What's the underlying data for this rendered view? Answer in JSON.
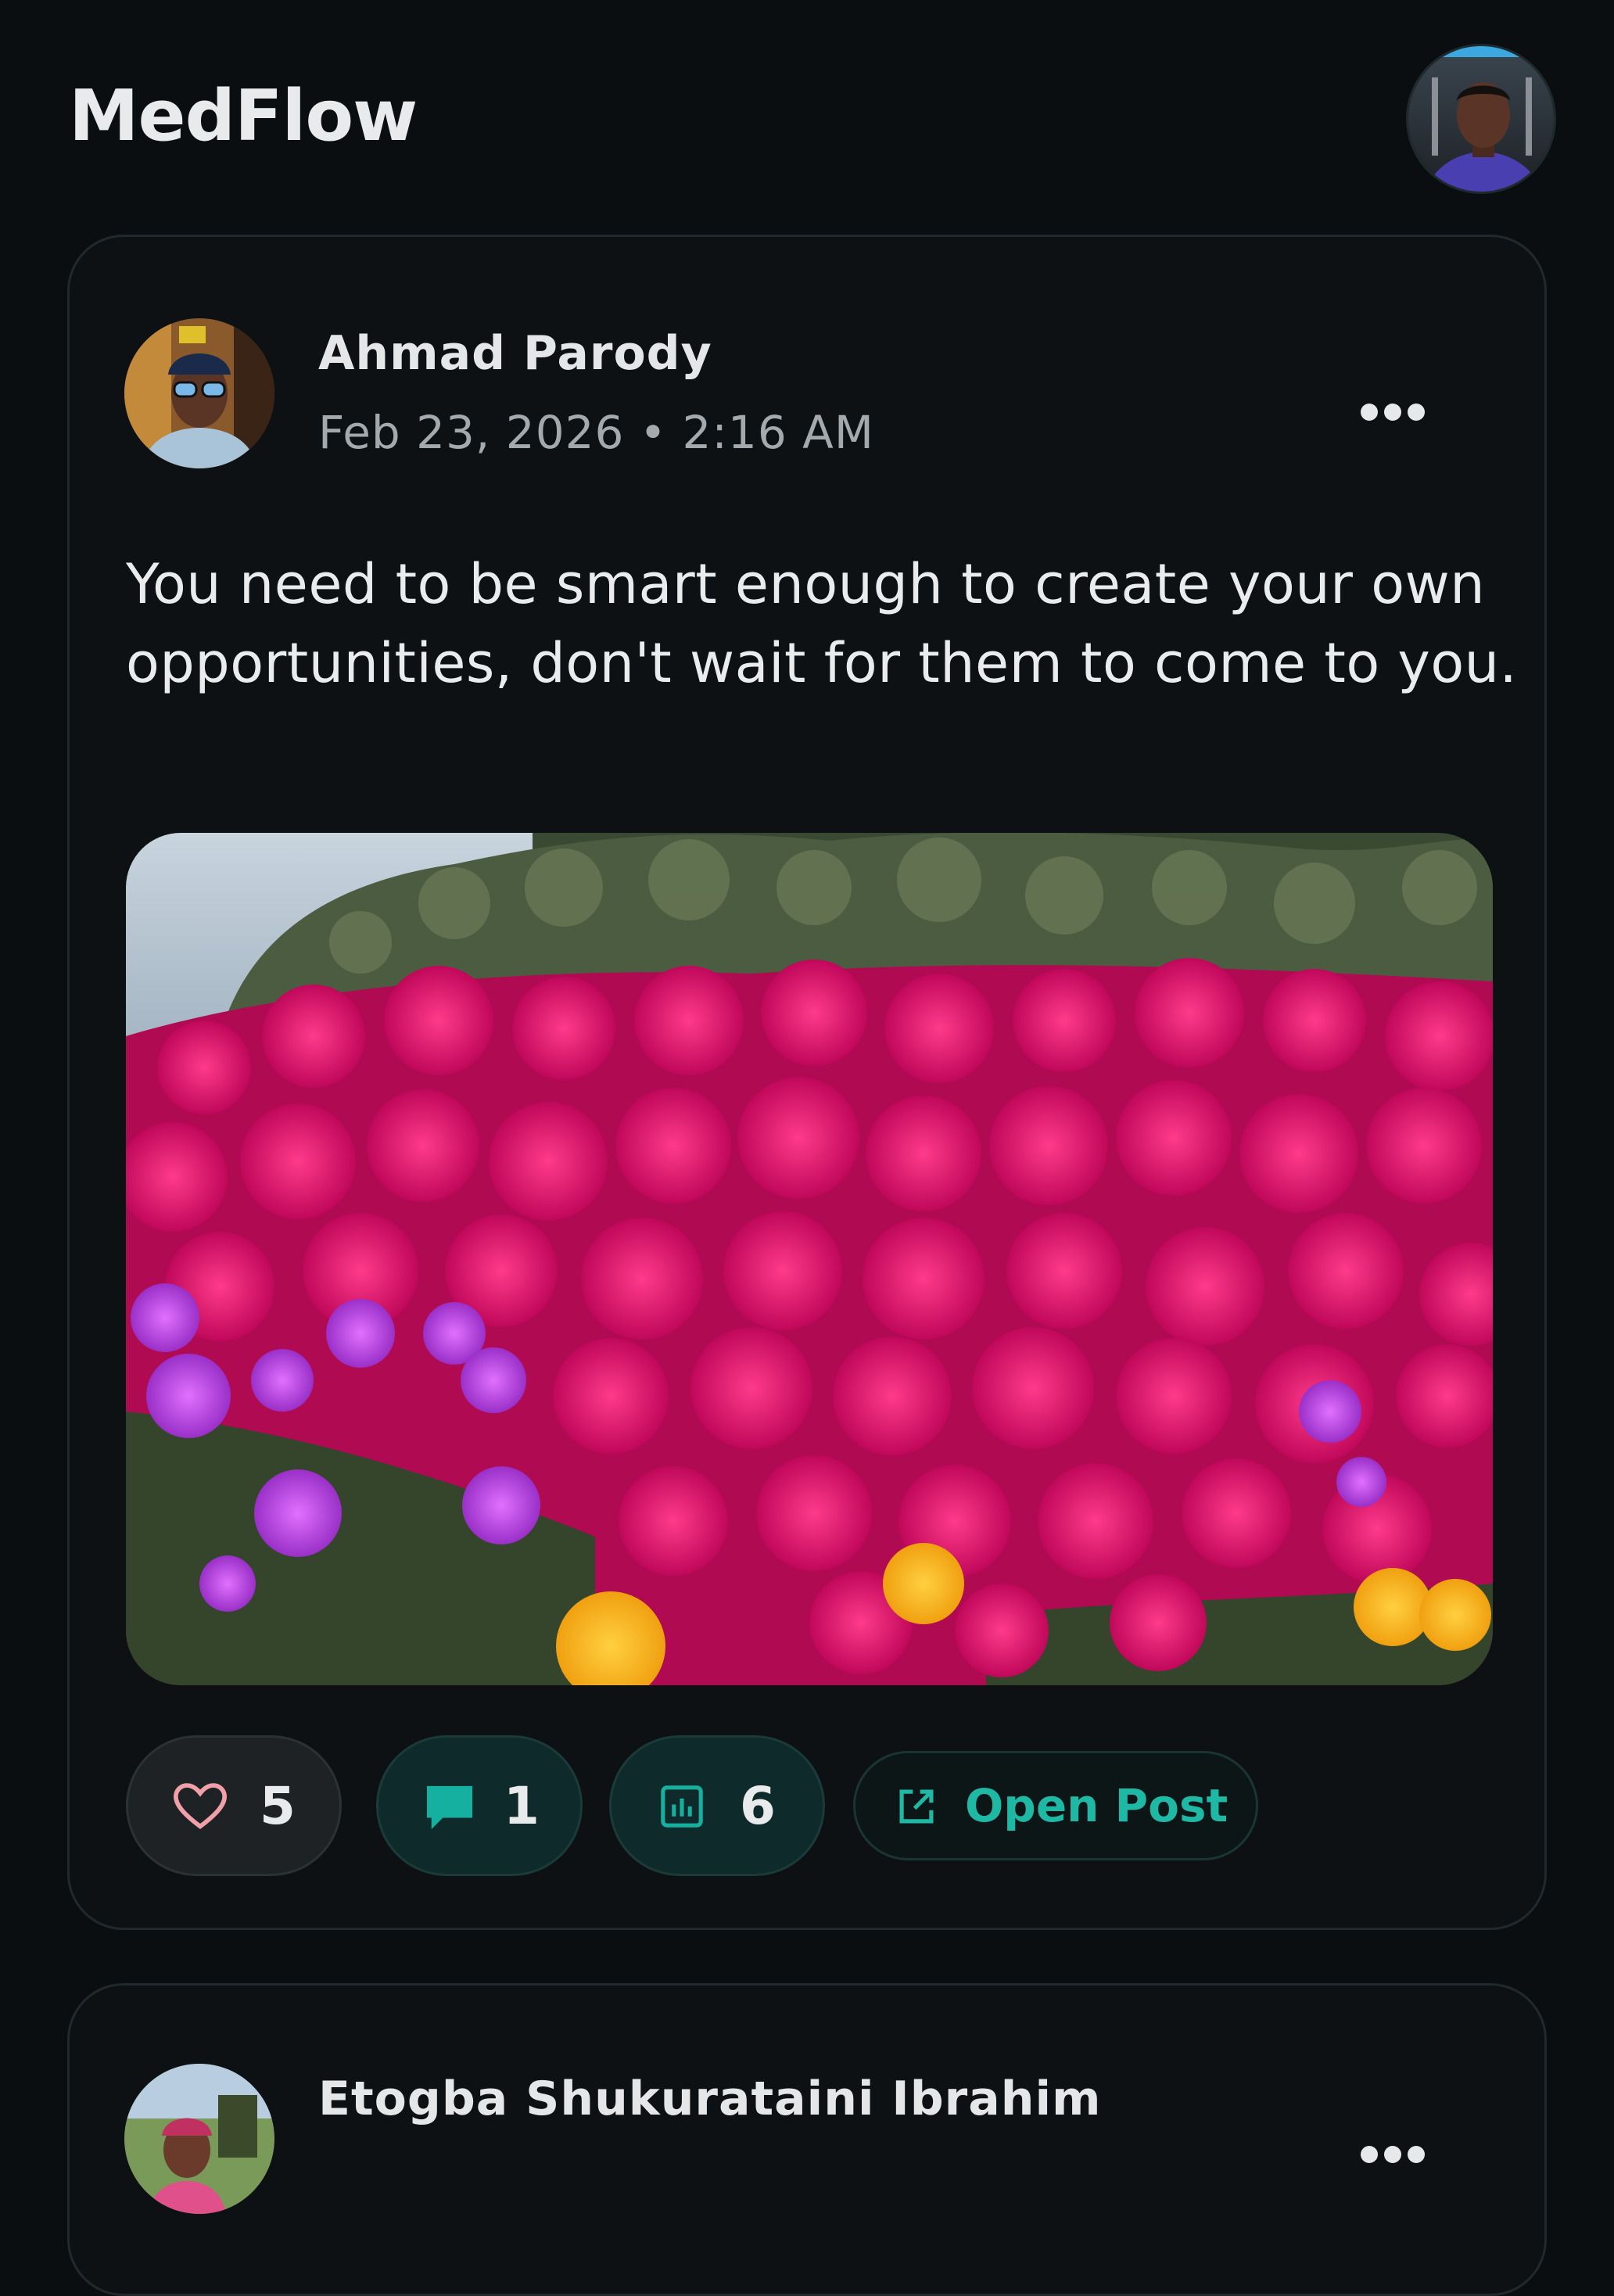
{
  "app": {
    "title": "MedFlow",
    "accent_color": "#1fb8a4"
  },
  "header": {
    "avatar_icon": "user-avatar"
  },
  "posts": [
    {
      "author": "Ahmad Parody",
      "meta": "Feb 23, 2026 • 2:16 AM",
      "text": "You need to be smart enough to create your own opportunities, don't wait for them to come to you.",
      "image_description_icon": "photo",
      "actions": {
        "likes": "5",
        "comments": "1",
        "views": "6",
        "open_label": "Open Post"
      }
    },
    {
      "author": "Etogba Shukurataini Ibrahim"
    }
  ]
}
